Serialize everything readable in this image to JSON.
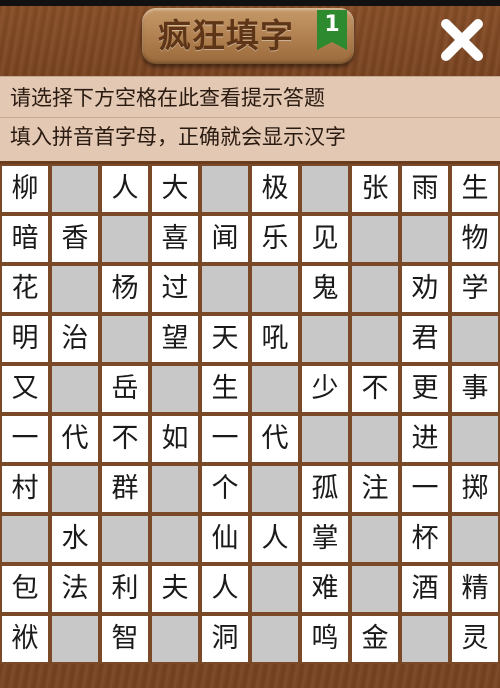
{
  "header": {
    "title": "疯狂填字",
    "level": "1"
  },
  "hints": {
    "line1": "请选择下方空格在此查看提示答题",
    "line2": "填入拼音首字母，正确就会显示汉字"
  },
  "colors": {
    "wood": "#7b4522",
    "hint_bg": "#e3c9b4",
    "cell_white": "#ffffff",
    "cell_blank": "#c8c8c8",
    "badge_green": "#2e8a2e"
  },
  "icons": {
    "close": "close-icon",
    "level_badge": "ribbon-badge-icon"
  },
  "grid": [
    [
      "柳",
      "",
      "人",
      "大",
      "",
      "极",
      "",
      "张",
      "雨",
      "生"
    ],
    [
      "暗",
      "香",
      "",
      "喜",
      "闻",
      "乐",
      "见",
      "",
      "",
      "物"
    ],
    [
      "花",
      "",
      "杨",
      "过",
      "",
      "",
      "鬼",
      "",
      "劝",
      "学"
    ],
    [
      "明",
      "治",
      "",
      "望",
      "天",
      "吼",
      "",
      "",
      "君",
      ""
    ],
    [
      "又",
      "",
      "岳",
      "",
      "生",
      "",
      "少",
      "不",
      "更",
      "事"
    ],
    [
      "一",
      "代",
      "不",
      "如",
      "一",
      "代",
      "",
      "",
      "进",
      ""
    ],
    [
      "村",
      "",
      "群",
      "",
      "个",
      "",
      "孤",
      "注",
      "一",
      "掷"
    ],
    [
      "",
      "水",
      "",
      "",
      "仙",
      "人",
      "掌",
      "",
      "杯",
      ""
    ],
    [
      "包",
      "法",
      "利",
      "夫",
      "人",
      "",
      "难",
      "",
      "酒",
      "精"
    ],
    [
      "袱",
      "",
      "智",
      "",
      "洞",
      "",
      "鸣",
      "金",
      "",
      "灵"
    ]
  ],
  "cell_types": [
    "wbwwbwbwww",
    "wwbwwwwbbw",
    "wbwwbbwbww",
    "wwbwwwbbwb",
    "wbwbwbwwww",
    "wwwwwwbbwb",
    "wbwbwbwwww",
    "bwbbwwwbwb",
    "wwwwwbwbww",
    "wbwbwbwwbw"
  ]
}
